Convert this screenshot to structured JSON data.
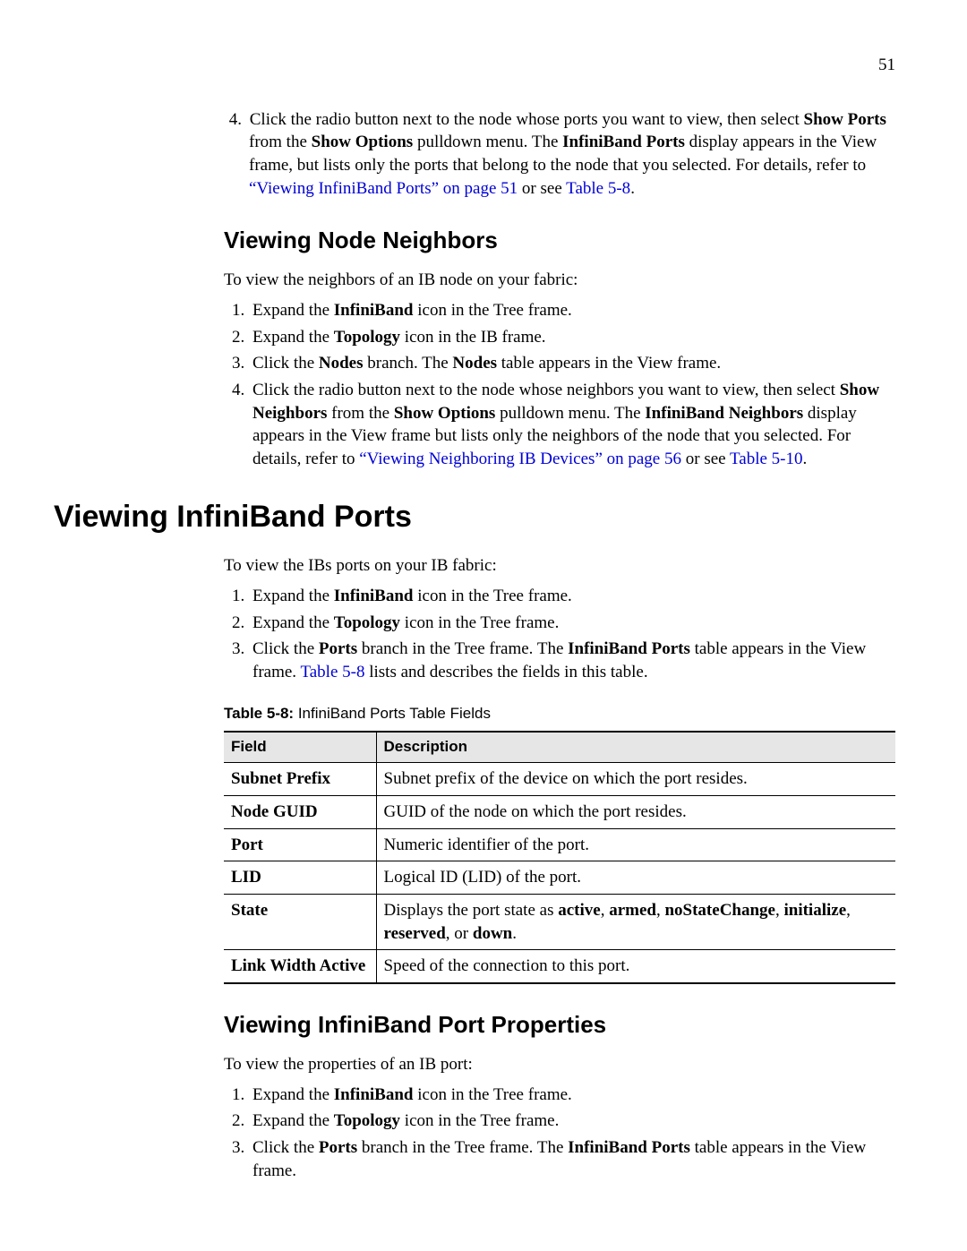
{
  "pageNumber": "51",
  "step4_top": {
    "num": "4.",
    "pre": "Click the radio button next to the node whose ports you want to view, then select ",
    "b1": "Show Ports",
    "mid1": " from the ",
    "b2": "Show Options",
    "mid2": " pulldown menu. The ",
    "b3": "InfiniBand Ports",
    "mid3": " display appears in the View frame, but lists only the ports that belong to the node that you selected. For details, refer to ",
    "link1": "“Viewing InfiniBand Ports” on page 51",
    "mid4": " or see ",
    "link2": "Table 5-8",
    "end": "."
  },
  "h2_neighbors": "Viewing Node Neighbors",
  "neighbors_intro": "To view the neighbors of an IB node on your fabric:",
  "neighbors_steps": {
    "s1": {
      "pre": "Expand the ",
      "b": "InfiniBand",
      "post": " icon in the Tree frame."
    },
    "s2": {
      "pre": "Expand the ",
      "b": "Topology",
      "post": " icon in the IB frame."
    },
    "s3": {
      "pre": "Click the ",
      "b1": "Nodes",
      "mid": " branch. The ",
      "b2": "Nodes",
      "post": " table appears in the View frame."
    },
    "s4": {
      "pre": "Click the radio button next to the node whose neighbors you want to view, then select ",
      "b1": "Show Neighbors",
      "mid1": " from the ",
      "b2": "Show Options",
      "mid2": " pulldown menu. The ",
      "b3": "InfiniBand Neighbors",
      "mid3": " display appears in the View frame but lists only the neighbors of the node that you selected. For details, refer to ",
      "link1": "“Viewing Neighboring IB Devices” on page 56",
      "mid4": " or see ",
      "link2": "Table 5-10",
      "end": "."
    }
  },
  "h1_ports": "Viewing InfiniBand Ports",
  "ports_intro": "To view the IBs ports on your IB fabric:",
  "ports_steps": {
    "s1": {
      "pre": "Expand the ",
      "b": "InfiniBand",
      "post": " icon in the Tree frame."
    },
    "s2": {
      "pre": "Expand the ",
      "b": "Topology",
      "post": " icon in the Tree frame."
    },
    "s3": {
      "pre": "Click the ",
      "b1": "Ports",
      "mid1": " branch in the Tree frame. The ",
      "b2": "InfiniBand Ports",
      "mid2": " table appears in the View frame. ",
      "link": "Table 5-8",
      "post": " lists and describes the fields in this table."
    }
  },
  "tableCaption": {
    "label": "Table 5-8:",
    "title": " InfiniBand Ports Table Fields"
  },
  "tableHead": {
    "c1": "Field",
    "c2": "Description"
  },
  "tableRows": {
    "r0": {
      "f": "Subnet Prefix",
      "d": "Subnet prefix of the device on which the port resides."
    },
    "r1": {
      "f": "Node GUID",
      "d": "GUID of the node on which the port resides."
    },
    "r2": {
      "f": "Port",
      "d": "Numeric identifier of the port."
    },
    "r3": {
      "f": "LID",
      "d": "Logical ID (LID) of the port."
    },
    "r4": {
      "f": "State",
      "d_pre": "Displays the port state as ",
      "b1": "active",
      "sep1": ", ",
      "b2": "armed",
      "sep2": ", ",
      "b3": "noStateChange",
      "sep3": ", ",
      "b4": "initialize",
      "sep4": ", ",
      "b5": "reserved",
      "sep5": ", or ",
      "b6": "down",
      "end": "."
    },
    "r5": {
      "f": "Link Width Active",
      "d": "Speed of the connection to this port."
    }
  },
  "h2_portprops": "Viewing InfiniBand Port Properties",
  "portprops_intro": "To view the properties of an IB port:",
  "portprops_steps": {
    "s1": {
      "pre": "Expand the ",
      "b": "InfiniBand",
      "post": " icon in the Tree frame."
    },
    "s2": {
      "pre": "Expand the ",
      "b": "Topology",
      "post": " icon in the Tree frame."
    },
    "s3": {
      "pre": "Click the ",
      "b1": "Ports",
      "mid": " branch in the Tree frame. The ",
      "b2": "InfiniBand Ports",
      "post": " table appears in the View frame."
    }
  }
}
